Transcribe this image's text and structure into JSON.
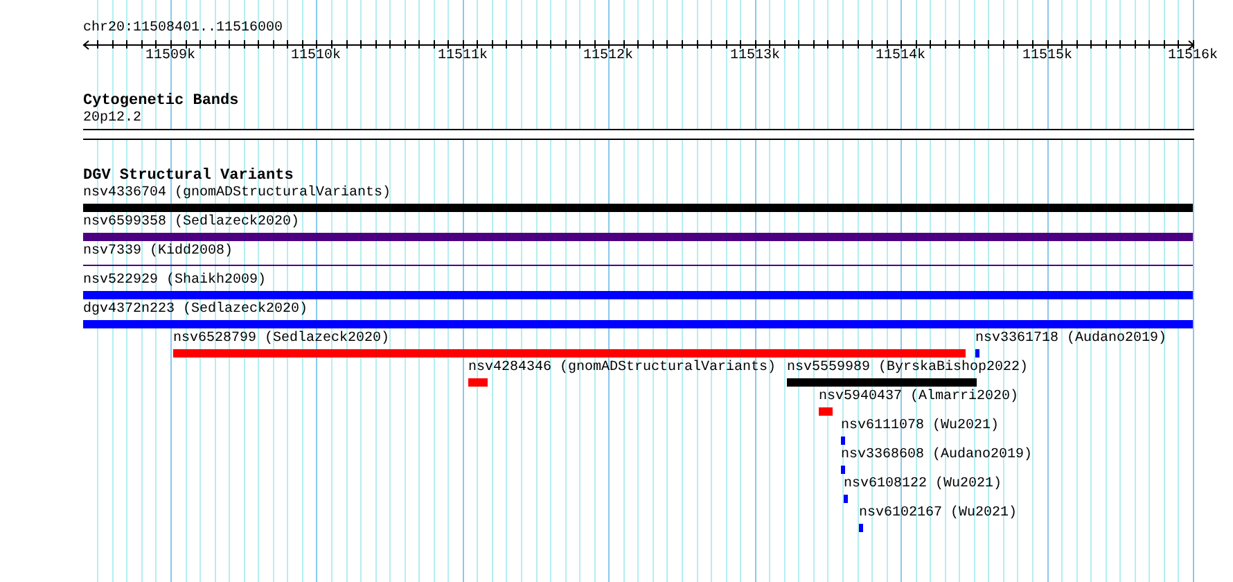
{
  "ruler": {
    "region": "chr20:11508401..11516000",
    "labels": [
      "11509k",
      "11510k",
      "11511k",
      "11512k",
      "11513k",
      "11514k",
      "11515k",
      "11516k"
    ]
  },
  "cytogenetic_bands": {
    "title": "Cytogenetic Bands",
    "band": "20p12.2"
  },
  "dgv_track": {
    "title": "DGV Structural Variants",
    "features": [
      {
        "label": "nsv4336704 (gnomADStructuralVariants)",
        "color": "#000000",
        "kind": "bar"
      },
      {
        "label": "nsv6599358 (Sedlazeck2020)",
        "color": "#4b0082",
        "kind": "bar"
      },
      {
        "label": "nsv7339 (Kidd2008)",
        "color": "#4b0082",
        "kind": "line"
      },
      {
        "label": "nsv522929 (Shaikh2009)",
        "color": "#0000ff",
        "kind": "bar"
      },
      {
        "label": "dgv4372n223 (Sedlazeck2020)",
        "color": "#0000ff",
        "kind": "bar"
      },
      {
        "label": "nsv6528799 (Sedlazeck2020)",
        "color": "#ff0000",
        "kind": "bar"
      },
      {
        "label": "nsv3361718 (Audano2019)",
        "color": "#0000ff",
        "kind": "bar"
      },
      {
        "label": "nsv4284346 (gnomADStructuralVariants)",
        "color": "#ff0000",
        "kind": "bar"
      },
      {
        "label": "nsv5559989 (ByrskaBishop2022)",
        "color": "#000000",
        "kind": "bar"
      },
      {
        "label": "nsv5940437 (Almarri2020)",
        "color": "#ff0000",
        "kind": "bar"
      },
      {
        "label": "nsv6111078 (Wu2021)",
        "color": "#0000ff",
        "kind": "bar"
      },
      {
        "label": "nsv3368608 (Audano2019)",
        "color": "#0000ff",
        "kind": "bar"
      },
      {
        "label": "nsv6108122 (Wu2021)",
        "color": "#0000ff",
        "kind": "bar"
      },
      {
        "label": "nsv6102167 (Wu2021)",
        "color": "#0000ff",
        "kind": "bar"
      }
    ]
  }
}
